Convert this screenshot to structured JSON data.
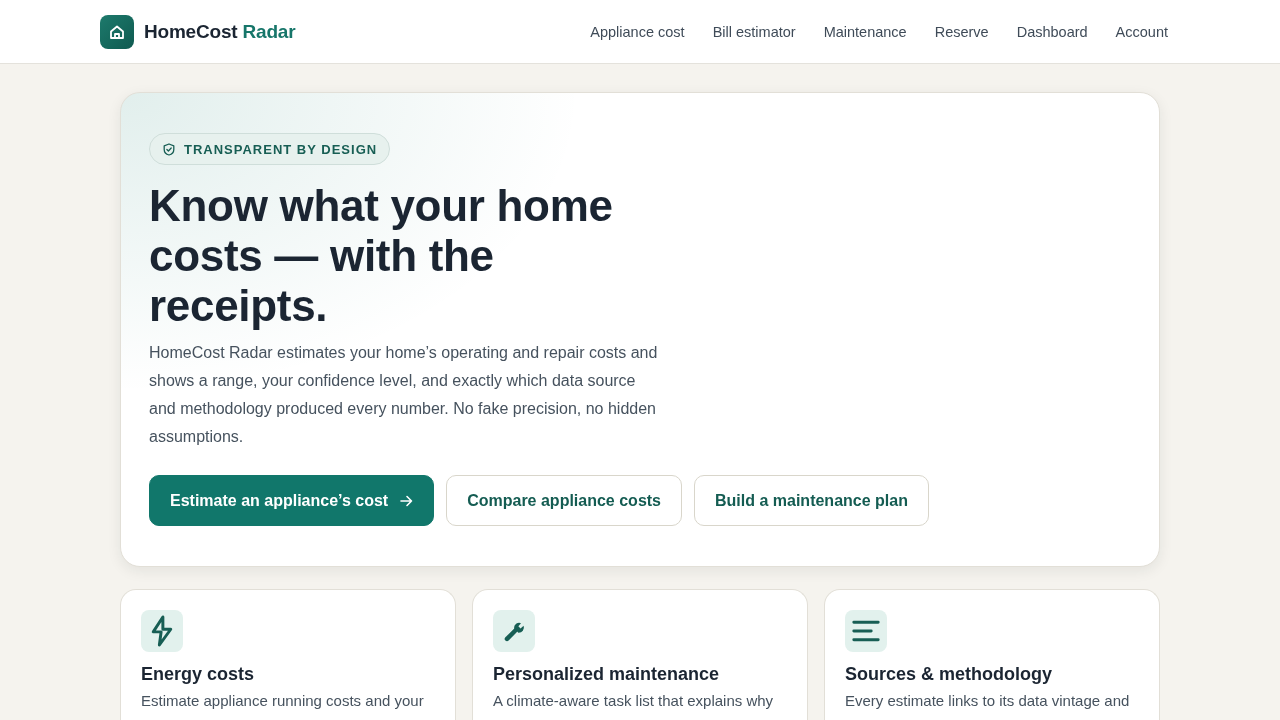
{
  "header": {
    "brand": {
      "name": "HomeCost",
      "accent": "Radar"
    },
    "nav": [
      "Appliance cost",
      "Bill estimator",
      "Maintenance",
      "Reserve",
      "Dashboard",
      "Account"
    ]
  },
  "hero": {
    "badge": "TRANSPARENT BY DESIGN",
    "title": "Know what your home costs — with the receipts.",
    "description": "HomeCost Radar estimates your home’s operating and repair costs and shows a range, your confidence level, and exactly which data source and methodology produced every number. No fake precision, no hidden assumptions.",
    "buttons": [
      {
        "label": "Estimate an appliance’s cost",
        "kind": "primary"
      },
      {
        "label": "Compare appliance costs",
        "kind": "secondary"
      },
      {
        "label": "Build a maintenance plan",
        "kind": "secondary"
      }
    ]
  },
  "features": [
    {
      "title": "Energy costs",
      "description": "Estimate appliance running costs and your"
    },
    {
      "title": "Personalized maintenance",
      "description": "A climate-aware task list that explains why"
    },
    {
      "title": "Sources & methodology",
      "description": "Every estimate links to its data vintage and"
    }
  ]
}
